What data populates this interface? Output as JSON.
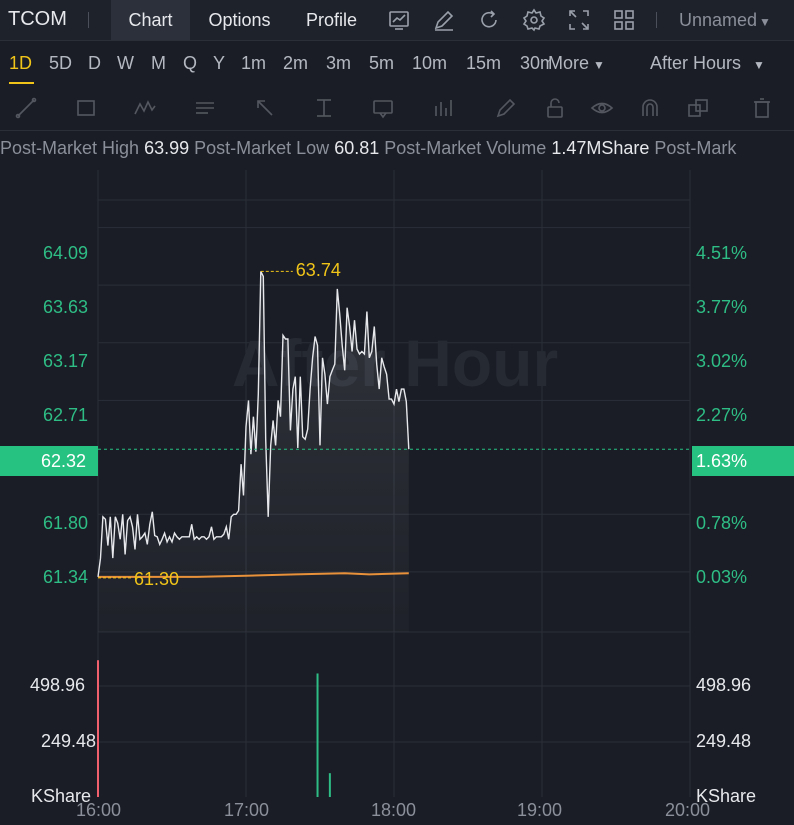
{
  "header": {
    "symbol": "TCOM",
    "tabs": [
      {
        "label": "Chart",
        "active": true
      },
      {
        "label": "Options",
        "active": false
      },
      {
        "label": "Profile",
        "active": false
      }
    ],
    "icons": [
      "indicator-icon",
      "edit-icon",
      "refresh-icon",
      "settings-icon",
      "fullscreen-icon",
      "layout-grid-icon"
    ],
    "layout_name": "Unnamed"
  },
  "periods": {
    "items": [
      "1D",
      "5D",
      "D",
      "W",
      "M",
      "Q",
      "Y",
      "1m",
      "2m",
      "3m",
      "5m",
      "10m",
      "15m",
      "30m"
    ],
    "active": "1D",
    "more_label": "More",
    "session_label": "After Hours"
  },
  "drawing_tools": [
    "trend-line-icon",
    "rectangle-icon",
    "pattern-icon",
    "text-note-icon",
    "arrow-icon",
    "measure-icon",
    "price-label-icon",
    "bar-pattern-icon",
    "brush-icon",
    "lock-icon",
    "eye-icon",
    "magnet-icon",
    "layers-icon",
    "trash-icon"
  ],
  "stats": {
    "high_label": "Post-Market High",
    "high_value": "63.99",
    "low_label": "Post-Market Low",
    "low_value": "60.81",
    "volume_label": "Post-Market Volume",
    "volume_value": "1.47MShare",
    "extra_label": "Post-Mark"
  },
  "colors": {
    "up": "#2ebd85",
    "down": "#f0616d",
    "highlight": "#f0c419",
    "price_line": "#e6e8ec",
    "avg_line": "#e8913a"
  },
  "chart_data": {
    "type": "line",
    "watermark": "After Hour",
    "x_ticks": [
      "16:00",
      "17:00",
      "18:00",
      "19:00",
      "20:00"
    ],
    "y_ticks": [
      "64.09",
      "63.63",
      "63.17",
      "62.71",
      "61.80",
      "61.34"
    ],
    "y_ticks_pct": [
      "4.51%",
      "3.77%",
      "3.02%",
      "2.27%",
      "0.78%",
      "0.03%"
    ],
    "ylim": [
      60.86,
      64.55
    ],
    "current_price": "62.32",
    "current_pct": "1.63%",
    "max_label": "63.74",
    "min_label": "61.30",
    "price": {
      "t": [
        0,
        1,
        2,
        3,
        4,
        5,
        6,
        7,
        8,
        9,
        10,
        11,
        12,
        13,
        14,
        15,
        16,
        17,
        18,
        19,
        20,
        21,
        22,
        23,
        24,
        25,
        26,
        27,
        28,
        29,
        30,
        31,
        32,
        33,
        34,
        35,
        36,
        37,
        38,
        39,
        40,
        41,
        42,
        43,
        44,
        45,
        46,
        47,
        48,
        49,
        50,
        51,
        52,
        53,
        54,
        55,
        56,
        57,
        58,
        59,
        60,
        61,
        62,
        63,
        64,
        65,
        66,
        67,
        68,
        69,
        70,
        71,
        72,
        73,
        74,
        75,
        76,
        77,
        78,
        79,
        80,
        81,
        82,
        83,
        84,
        85,
        86,
        87,
        88,
        89,
        90,
        91,
        92,
        93,
        94,
        95,
        96,
        97,
        98,
        99,
        100,
        101,
        102,
        103,
        104,
        105,
        106,
        107,
        108,
        109,
        110,
        111,
        112,
        113,
        114,
        115,
        116,
        117,
        118,
        119,
        120,
        121,
        122,
        123,
        124,
        125,
        126
      ],
      "v": [
        61.3,
        61.45,
        61.78,
        61.76,
        61.55,
        61.78,
        61.45,
        61.78,
        61.73,
        61.6,
        61.8,
        61.48,
        61.75,
        61.78,
        61.7,
        61.52,
        61.8,
        61.6,
        61.62,
        61.65,
        61.56,
        61.72,
        61.82,
        61.63,
        61.62,
        61.56,
        61.6,
        61.65,
        61.58,
        61.62,
        61.58,
        61.65,
        61.62,
        61.6,
        61.62,
        61.62,
        61.62,
        61.62,
        61.72,
        61.6,
        61.62,
        61.6,
        61.62,
        61.62,
        61.6,
        61.62,
        61.7,
        61.6,
        61.62,
        61.62,
        61.62,
        61.64,
        61.7,
        61.6,
        61.78,
        61.8,
        61.8,
        61.83,
        62.2,
        61.95,
        62.5,
        62.71,
        62.28,
        62.58,
        62.3,
        62.76,
        63.74,
        63.7,
        62.4,
        61.78,
        62.35,
        62.55,
        62.35,
        62.71,
        62.58,
        63.23,
        63.2,
        63.2,
        62.47,
        62.8,
        62.9,
        62.33,
        62.9,
        62.42,
        62.4,
        62.48,
        62.8,
        63.05,
        63.22,
        63.15,
        62.35,
        63.05,
        62.92,
        62.68,
        62.9,
        62.95,
        63.0,
        63.6,
        63.4,
        63.15,
        62.95,
        63.45,
        63.3,
        63.1,
        63.35,
        63.12,
        63.08,
        63.1,
        63.08,
        63.42,
        63.05,
        63.1,
        63.3,
        63.0,
        62.8,
        63.05,
        62.98,
        62.92,
        62.72,
        62.72,
        62.68,
        62.8,
        62.7,
        62.8,
        62.8,
        62.7,
        62.32
      ]
    },
    "average": {
      "t": [
        0,
        20,
        40,
        60,
        80,
        100,
        110,
        126
      ],
      "v": [
        61.3,
        61.3,
        61.3,
        61.31,
        61.32,
        61.33,
        61.32,
        61.33
      ]
    },
    "volume": {
      "y_ticks": [
        "498.96",
        "249.48"
      ],
      "unit": "KShare",
      "ylim": [
        0,
        748
      ],
      "bars": [
        {
          "t": 0,
          "v": 620,
          "dir": "down"
        },
        {
          "t": 89,
          "v": 560,
          "dir": "up"
        },
        {
          "t": 94,
          "v": 108,
          "dir": "up"
        }
      ]
    }
  }
}
